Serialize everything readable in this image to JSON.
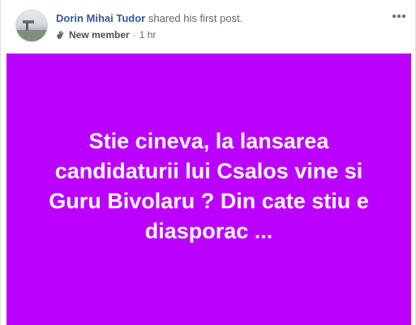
{
  "post": {
    "author_name": "Dorin Mihai Tudor",
    "action_text": "shared his first post.",
    "badge_label": "New member",
    "badge_icon": "wave-hand-icon",
    "separator": "·",
    "timestamp": "1 hr",
    "more_icon": "more-options-icon",
    "body_text": "Stie cineva, la lansarea candidaturii lui Csalos vine si Guru Bivolaru ? Din cate stiu e diasporac ...",
    "background_color": "#bb00ff",
    "text_color": "#ffffff",
    "name_color": "#385898"
  }
}
